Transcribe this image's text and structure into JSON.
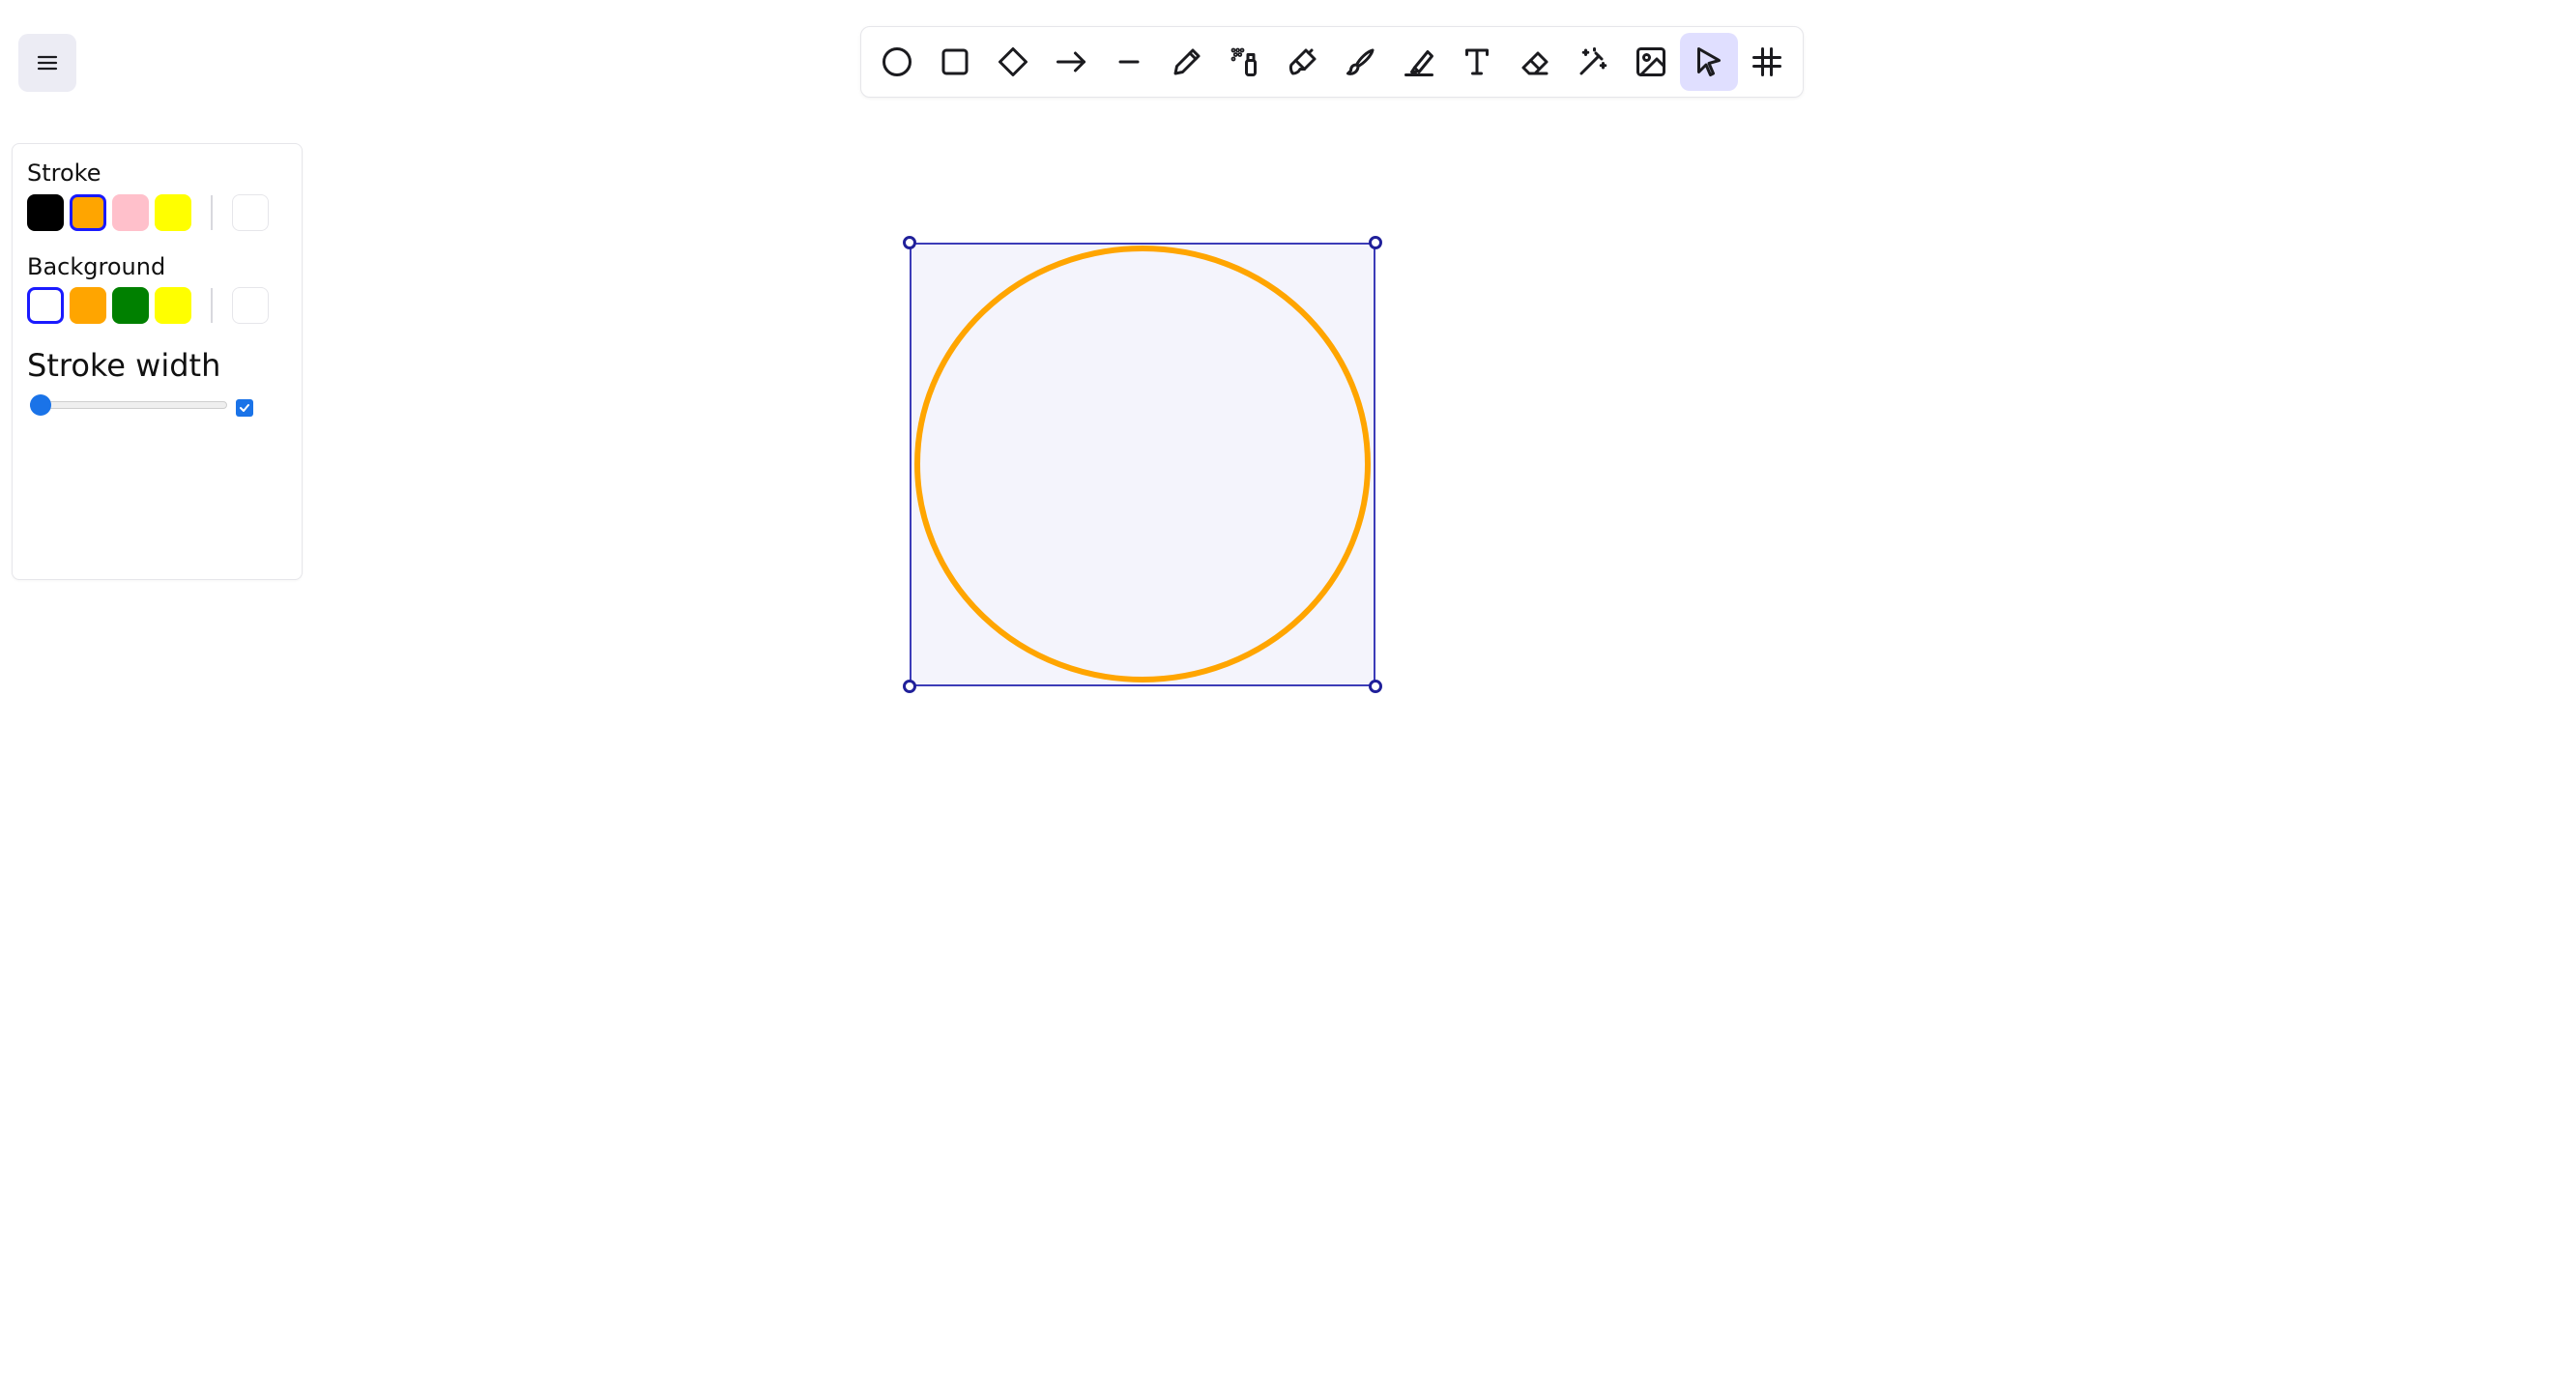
{
  "menu": {
    "icon": "hamburger-icon"
  },
  "toolbar": {
    "tools": [
      {
        "name": "ellipse",
        "icon": "circle-icon"
      },
      {
        "name": "rectangle",
        "icon": "square-icon"
      },
      {
        "name": "diamond",
        "icon": "diamond-icon"
      },
      {
        "name": "arrow",
        "icon": "arrow-right-icon"
      },
      {
        "name": "line",
        "icon": "line-icon"
      },
      {
        "name": "pencil",
        "icon": "pencil-icon"
      },
      {
        "name": "spray",
        "icon": "spray-can-icon"
      },
      {
        "name": "brush",
        "icon": "paintbrush-icon"
      },
      {
        "name": "brush-alt",
        "icon": "brush-stroke-icon"
      },
      {
        "name": "highlighter",
        "icon": "highlighter-icon"
      },
      {
        "name": "text",
        "icon": "text-icon"
      },
      {
        "name": "eraser",
        "icon": "eraser-icon"
      },
      {
        "name": "magic",
        "icon": "magic-wand-icon"
      },
      {
        "name": "image",
        "icon": "image-icon"
      },
      {
        "name": "select",
        "icon": "cursor-icon"
      },
      {
        "name": "grid",
        "icon": "hash-icon"
      }
    ],
    "active_tool": "select"
  },
  "panel": {
    "stroke_label": "Stroke",
    "stroke_colors": [
      "#000000",
      "#ffa500",
      "#ffc0cb",
      "#ffff00"
    ],
    "stroke_selected": "#ffa500",
    "background_label": "Background",
    "background_colors": [
      "transparent",
      "#ffa500",
      "#008000",
      "#ffff00"
    ],
    "background_selected": "transparent",
    "stroke_width_label": "Stroke width",
    "stroke_width_value": 0,
    "stroke_width_checked": true
  },
  "canvas": {
    "shape": "ellipse",
    "stroke_color": "#ffa500",
    "selected": true
  },
  "colors": {
    "accent": "#1a1aff",
    "selection": "#3c3cb8",
    "tool_active_bg": "#e0dfff"
  }
}
